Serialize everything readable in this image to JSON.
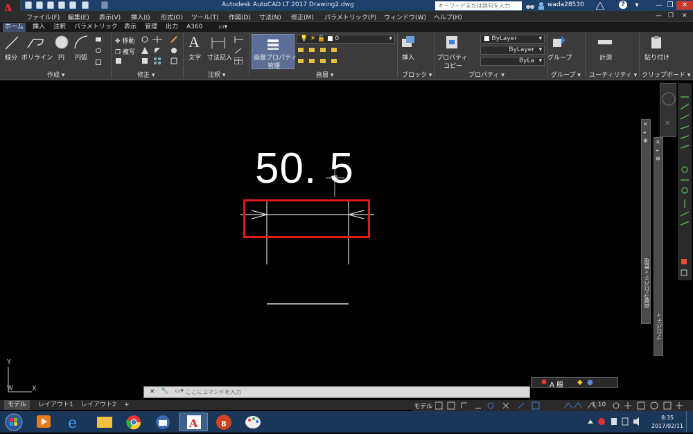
{
  "titlebar": {
    "title": "Autodesk AutoCAD LT 2017    Drawing2.dwg",
    "search_placeholder": "キーワードまたは語句を入力",
    "username": "wada28530",
    "help": "?",
    "app_letter": "A",
    "app_sub": "LT"
  },
  "menubar": {
    "items": [
      "ファイル(F)",
      "編集(E)",
      "表示(V)",
      "挿入(I)",
      "形式(O)",
      "ツール(T)",
      "作図(D)",
      "寸法(N)",
      "修正(M)",
      "パラメトリック(P)",
      "ウィンドウ(W)",
      "ヘルプ(H)"
    ]
  },
  "tabs": [
    "ホーム",
    "挿入",
    "注釈",
    "パラメトリック",
    "表示",
    "管理",
    "出力",
    "A360"
  ],
  "ribbon": {
    "draw": {
      "line": "線分",
      "polyline": "ポリライン",
      "circle": "円",
      "arc": "円弧",
      "title": "作成 ▾"
    },
    "modify": {
      "move": "移動",
      "copy": "複写",
      "title": "修正 ▾"
    },
    "annotation": {
      "text": "文字",
      "dimension": "寸法記入",
      "title": "注釈 ▾"
    },
    "layers": {
      "props_btn_line1": "画層プロパティ",
      "props_btn_line2": "管理",
      "current_layer": "0",
      "title": "画層 ▾"
    },
    "block": {
      "insert": "挿入",
      "title": "ブロック ▾"
    },
    "properties": {
      "match_line1": "プロパティ",
      "match_line2": "コピー",
      "color": "ByLayer",
      "linetype": "ByLayer",
      "lineweight": "ByLa",
      "title": "プロパティ ▾"
    },
    "groups": {
      "group": "グループ",
      "title": "グループ ▾"
    },
    "utilities": {
      "measure": "計測",
      "title": "ユーティリティ ▾"
    },
    "clipboard": {
      "paste": "貼り付け",
      "title": "クリップボード ▾"
    }
  },
  "canvas": {
    "dimension_text": "50. 5",
    "ucs_y": "Y",
    "ucs_w": "W",
    "ucs_x": "X"
  },
  "palettes": {
    "layer_props": "画層プロパティ管理",
    "properties": "プロパティ"
  },
  "command": {
    "placeholder": "ここにコマンドを入力",
    "close": "✕",
    "wrench": "🔧"
  },
  "ime": {
    "mode": "A 般"
  },
  "layout_tabs": [
    "モデル",
    "レイアウト1",
    "レイアウト2",
    "+"
  ],
  "statusbar": {
    "model": "モデル",
    "scale": "1:10"
  },
  "taskbar": {
    "time": "8:35",
    "date": "2017/02/11"
  },
  "colors": {
    "highlight": "#e01b1b",
    "ribbon_bg": "#3b3b3b",
    "titlebar": "#1f3f6b",
    "taskbar": "#1a3658"
  }
}
